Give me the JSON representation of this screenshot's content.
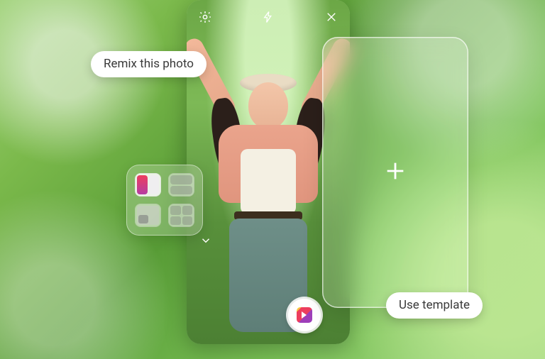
{
  "tooltips": {
    "remix": "Remix this photo",
    "use_template": "Use template"
  },
  "topbar": {
    "settings_icon": "settings-icon",
    "flash_icon": "flash-icon",
    "close_icon": "close-icon"
  },
  "layout_picker": {
    "options": [
      {
        "name": "split-vertical",
        "active": true
      },
      {
        "name": "split-horizontal",
        "active": false
      },
      {
        "name": "picture-in-picture",
        "active": false
      },
      {
        "name": "grid",
        "active": false
      }
    ]
  },
  "capture": {
    "label": "reels-icon"
  },
  "add_panel": {
    "icon": "plus-icon"
  },
  "chevron": {
    "icon": "chevron-down-icon"
  }
}
